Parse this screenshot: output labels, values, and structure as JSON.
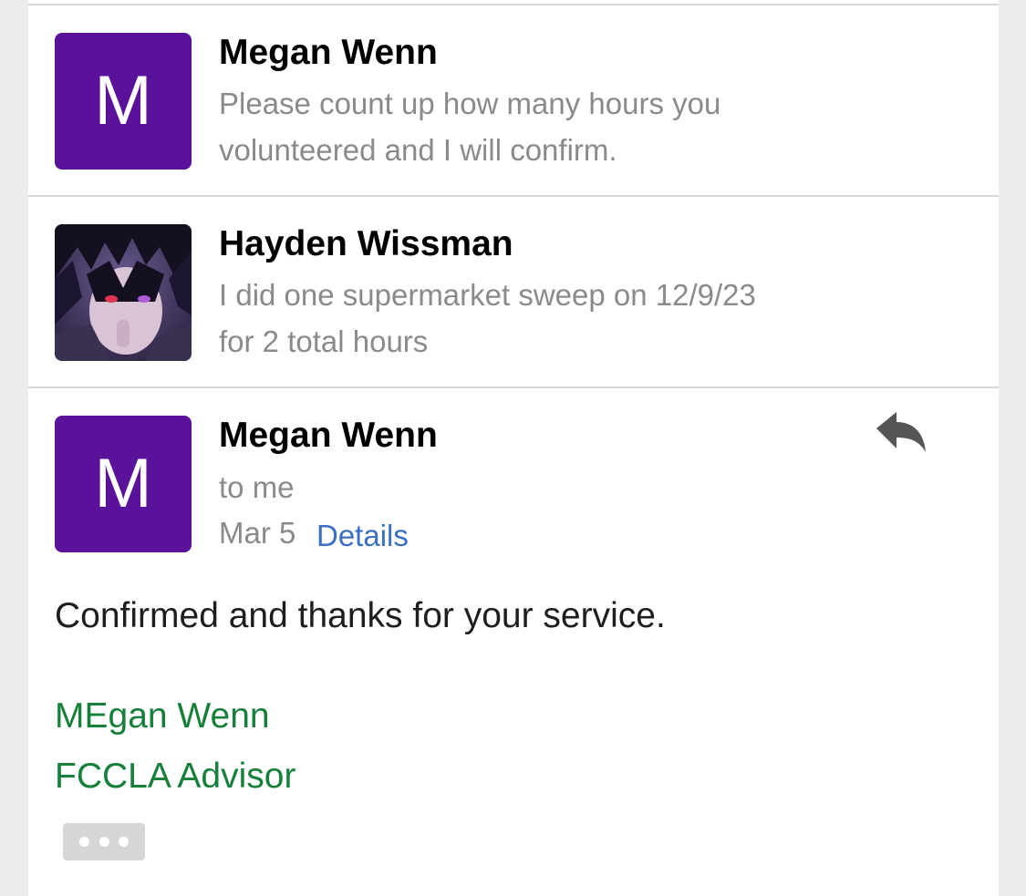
{
  "thread": [
    {
      "sender": "Megan Wenn",
      "avatar_letter": "M",
      "avatar_color": "#5b129a",
      "snippet_lines": [
        "Please count up how many hours you",
        "volunteered and I will confirm."
      ]
    },
    {
      "sender": "Hayden Wissman",
      "avatar_image": "anime-character-photo",
      "snippet_lines": [
        "I did one supermarket sweep on 12/9/23",
        "for 2 total hours"
      ]
    }
  ],
  "open_message": {
    "sender": "Megan Wenn",
    "avatar_letter": "M",
    "avatar_color": "#5b129a",
    "recipient": "to me",
    "date": "Mar 5",
    "details_link": "Details",
    "reply_icon": "reply-arrow-icon",
    "body": "Confirmed and thanks for your service.",
    "signature": [
      "MEgan Wenn",
      "FCCLA Advisor"
    ],
    "signature_color": "#16803a",
    "more_icon": "ellipsis-icon"
  }
}
